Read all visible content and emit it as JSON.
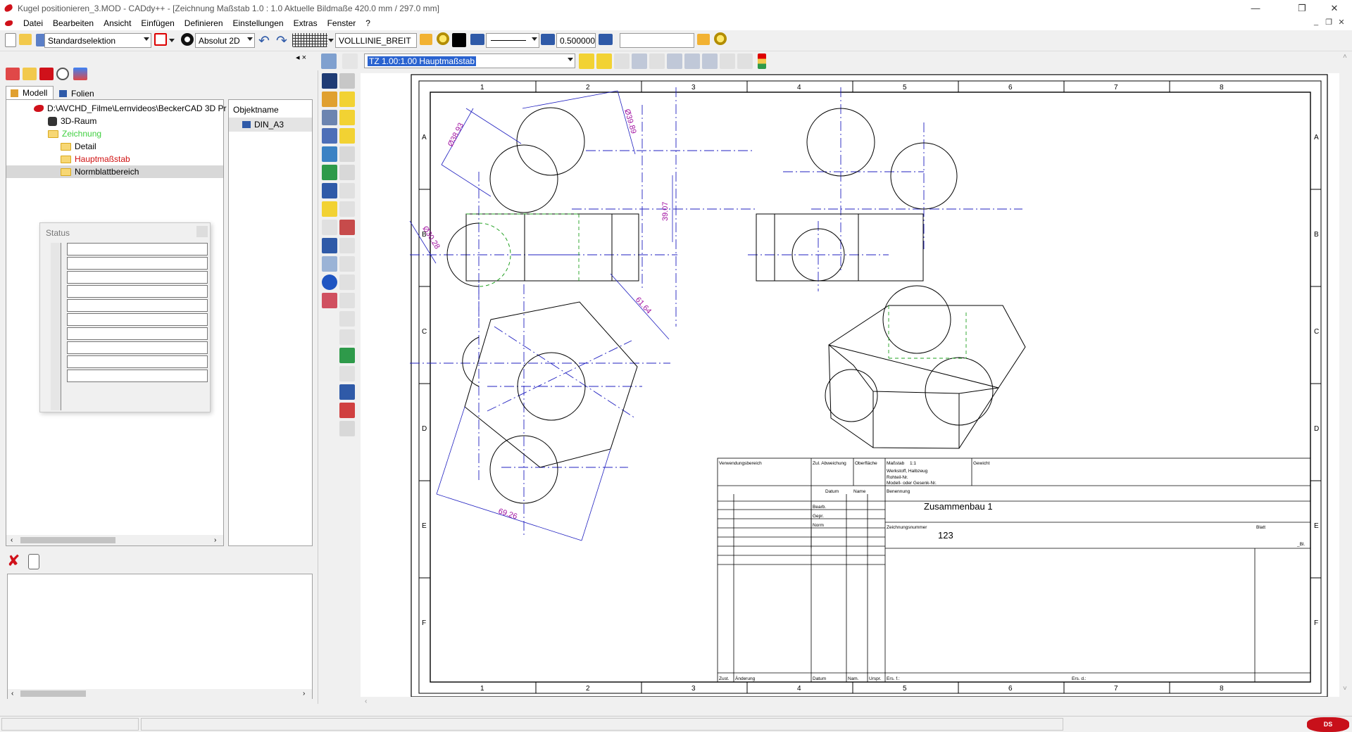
{
  "window": {
    "title": "Kugel positionieren_3.MOD  -  CADdy++ - [Zeichnung   Maßstab 1.0 : 1.0   Aktuelle Bildmaße 420.0 mm / 297.0 mm]",
    "minimize": "—",
    "maximize": "❐",
    "close": "✕"
  },
  "menu": [
    "Datei",
    "Bearbeiten",
    "Ansicht",
    "Einfügen",
    "Definieren",
    "Einstellungen",
    "Extras",
    "Fenster",
    "?"
  ],
  "toolbar": {
    "selection_mode": "Standardselektion",
    "coord_mode": "Absolut 2D",
    "line_type": "VOLLLINIE_BREIT",
    "line_width": "0.500000",
    "search_value": ""
  },
  "view_toolbar": {
    "scale_zone": "TZ 1.00:1.00 Hauptmaßstab"
  },
  "left_panel": {
    "tabs": [
      "Modell",
      "Folien"
    ],
    "tree": [
      {
        "label": "D:\\AVCHD_Filme\\Lernvideos\\BeckerCAD 3D Pr",
        "color": "#000"
      },
      {
        "label": "3D-Raum",
        "color": "#000"
      },
      {
        "label": "Zeichnung",
        "color": "#3fcf3f"
      },
      {
        "label": "Detail",
        "color": "#000"
      },
      {
        "label": "Hauptmaßstab",
        "color": "#d01010"
      },
      {
        "label": "Normblattbereich",
        "color": "#000"
      }
    ],
    "object_header": "Objektname",
    "objects": [
      "DIN_A3"
    ],
    "status_title": "Status"
  },
  "drawing": {
    "dimensions": {
      "d1": "Ø38.93",
      "d2": "Ø39.89",
      "d3": "Ø30.28",
      "d4": "39.07",
      "d5": "61.64",
      "d6": "69.26"
    },
    "column_labels": [
      "1",
      "2",
      "3",
      "4",
      "5",
      "6",
      "7",
      "8"
    ],
    "row_labels": [
      "A",
      "B",
      "C",
      "D",
      "E",
      "F"
    ],
    "title_block": {
      "verwendung": "Verwendungsbereich",
      "zul_abweichung": "Zul. Abweichung",
      "oberflaeche": "Oberfläche",
      "massstab_label": "Maßstab",
      "massstab_value": "1:1",
      "gewicht": "Gewicht",
      "werkstoff": "Werkstoff, Halbzeug",
      "rohteil": "Rohteil-Nr.",
      "modell": "Modell- oder Gesenk-Nr.",
      "datum": "Datum",
      "name": "Name",
      "bearb": "Bearb.",
      "gepr": "Gepr.",
      "norm": "Norm",
      "benennung": "Benennung",
      "benennung_value": "Zusammenbau 1",
      "zeichnungsnummer": "Zeichnungsnummer",
      "zeichnungsnummer_value": "123",
      "blatt": "Blatt",
      "bl": "_Bl.",
      "zust": "Zust.",
      "aenderung": "Änderung",
      "datum2": "Datum",
      "nam": "Nam.",
      "urspr": "Urspr.",
      "ers_f": "Ers. f.:",
      "ers_d": "Ers. d.:"
    }
  }
}
